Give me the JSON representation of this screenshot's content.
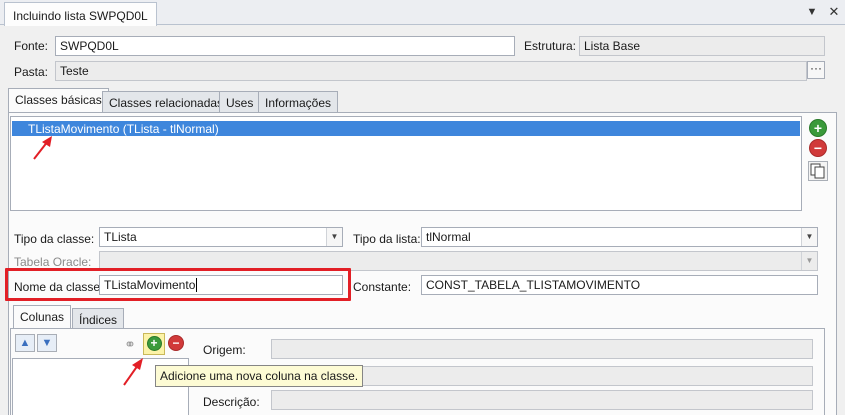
{
  "window": {
    "tab_title": "Incluindo lista SWPQD0L",
    "dropdown_icon": "chevron-down-icon",
    "close_icon": "close-icon"
  },
  "header": {
    "fonte_label": "Fonte:",
    "fonte_value": "SWPQD0L",
    "estrutura_label": "Estrutura:",
    "estrutura_value": "Lista Base",
    "pasta_label": "Pasta:",
    "pasta_value": "Teste",
    "pasta_button": "···"
  },
  "main_tabs": [
    "Classes básicas",
    "Classes relacionadas",
    "Uses",
    "Informações"
  ],
  "class_list": {
    "items": [
      "TListaMovimento (TLista - tlNormal)"
    ]
  },
  "class_form": {
    "tipo_classe_label": "Tipo da classe:",
    "tipo_classe_value": "TLista",
    "tipo_lista_label": "Tipo da lista:",
    "tipo_lista_value": "tlNormal",
    "tabela_oracle_label": "Tabela Oracle:",
    "tabela_oracle_value": "",
    "nome_classe_label": "Nome da classe:",
    "nome_classe_value": "TListaMovimento",
    "constante_label": "Constante:",
    "constante_value": "CONST_TABELA_TLISTAMOVIMENTO"
  },
  "sub_tabs": [
    "Colunas",
    "Índices"
  ],
  "column_form": {
    "origem_label": "Origem:",
    "descricao_label": "Descrição:"
  },
  "tooltip": {
    "text": "Adicione uma nova coluna na classe."
  },
  "colors": {
    "accent": "#3e86dc",
    "annotation_red": "#e21f26",
    "add_green": "#3b9a3b",
    "remove_red": "#d13a3a"
  }
}
